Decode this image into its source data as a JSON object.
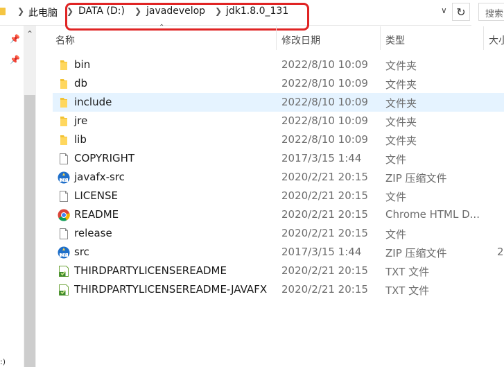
{
  "address_bar": {
    "crumbs": [
      "此电脑",
      "DATA (D:)",
      "javadevelop",
      "jdk1.8.0_131"
    ],
    "search_placeholder": "搜索"
  },
  "nav_pane": {
    "drive_label": ":)"
  },
  "columns": {
    "name": "名称",
    "date": "修改日期",
    "type": "类型",
    "size": "大小"
  },
  "files": [
    {
      "name": "bin",
      "date": "2022/8/10 10:09",
      "type": "文件夹",
      "size": "",
      "icon": "folder-icon"
    },
    {
      "name": "db",
      "date": "2022/8/10 10:09",
      "type": "文件夹",
      "size": "",
      "icon": "folder-icon"
    },
    {
      "name": "include",
      "date": "2022/8/10 10:09",
      "type": "文件夹",
      "size": "",
      "icon": "folder-icon",
      "selected": true
    },
    {
      "name": "jre",
      "date": "2022/8/10 10:09",
      "type": "文件夹",
      "size": "",
      "icon": "folder-icon"
    },
    {
      "name": "lib",
      "date": "2022/8/10 10:09",
      "type": "文件夹",
      "size": "",
      "icon": "folder-icon"
    },
    {
      "name": "COPYRIGHT",
      "date": "2017/3/15 1:44",
      "type": "文件",
      "size": "",
      "icon": "file-icon"
    },
    {
      "name": "javafx-src",
      "date": "2020/2/21 20:15",
      "type": "ZIP 压缩文件",
      "size": "",
      "icon": "zip-icon"
    },
    {
      "name": "LICENSE",
      "date": "2020/2/21 20:15",
      "type": "文件",
      "size": "",
      "icon": "file-icon"
    },
    {
      "name": "README",
      "date": "2020/2/21 20:15",
      "type": "Chrome HTML D...",
      "size": "",
      "icon": "chrome-icon"
    },
    {
      "name": "release",
      "date": "2020/2/21 20:15",
      "type": "文件",
      "size": "",
      "icon": "file-icon"
    },
    {
      "name": "src",
      "date": "2017/3/15 1:44",
      "type": "ZIP 压缩文件",
      "size": "2",
      "icon": "zip-icon"
    },
    {
      "name": "THIRDPARTYLICENSEREADME",
      "date": "2020/2/21 20:15",
      "type": "TXT 文件",
      "size": "",
      "icon": "txt-icon"
    },
    {
      "name": "THIRDPARTYLICENSEREADME-JAVAFX",
      "date": "2020/2/21 20:15",
      "type": "TXT 文件",
      "size": "",
      "icon": "txt-icon"
    }
  ]
}
